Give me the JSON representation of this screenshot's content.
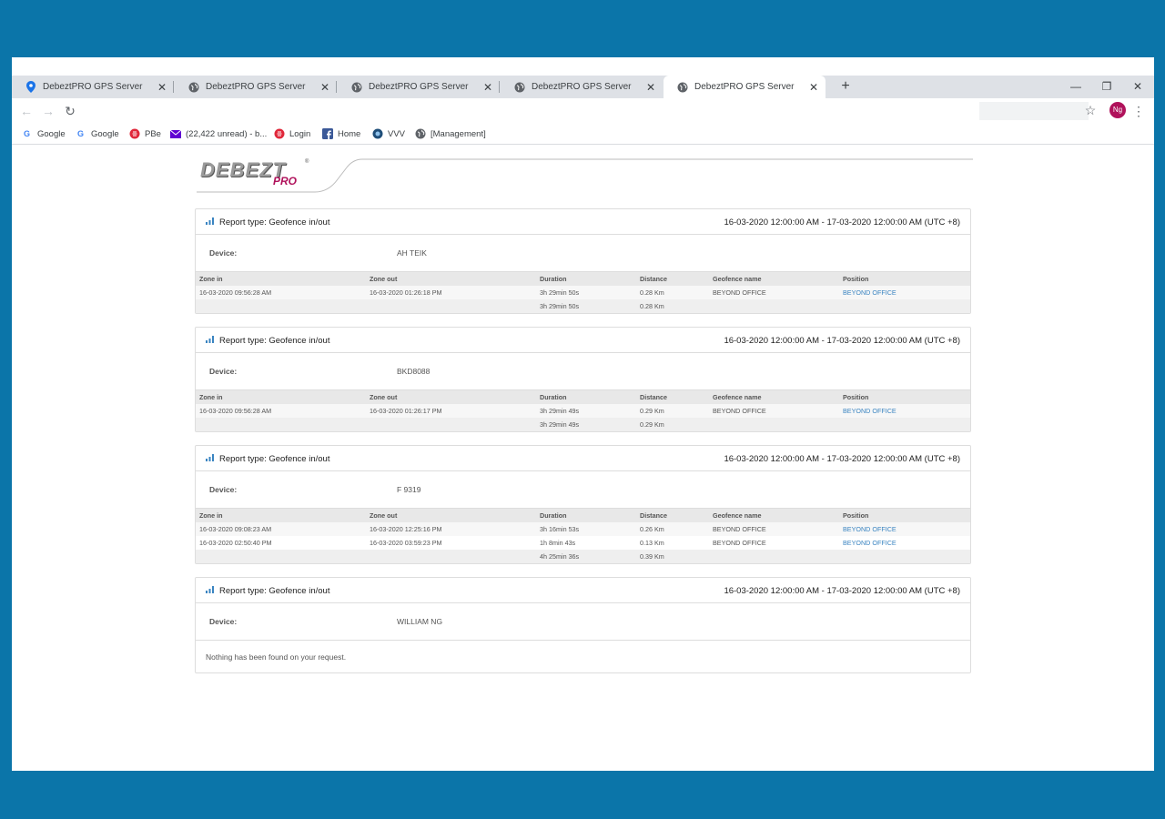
{
  "browser": {
    "tabs": [
      {
        "title": "DebeztPRO GPS Server",
        "icon": "map-pin-icon"
      },
      {
        "title": "DebeztPRO GPS Server",
        "icon": "globe-icon"
      },
      {
        "title": "DebeztPRO GPS Server",
        "icon": "globe-icon"
      },
      {
        "title": "DebeztPRO GPS Server",
        "icon": "globe-icon"
      },
      {
        "title": "DebeztPRO GPS Server",
        "icon": "globe-icon"
      }
    ],
    "active_tab": 4,
    "profile_initials": "Ng",
    "bookmarks": [
      {
        "label": "Google",
        "icon": "google-icon"
      },
      {
        "label": "Google",
        "icon": "google-icon"
      },
      {
        "label": "PBe",
        "icon": "pbe-icon"
      },
      {
        "label": "(22,422 unread) - b...",
        "icon": "mail-icon"
      },
      {
        "label": "Login",
        "icon": "pbe-icon"
      },
      {
        "label": "Home",
        "icon": "facebook-icon"
      },
      {
        "label": "VVV",
        "icon": "vvv-icon"
      },
      {
        "label": "[Management]",
        "icon": "globe-icon"
      }
    ]
  },
  "logo": {
    "main": "DEBEZT",
    "sub": "PRO",
    "tm": "®"
  },
  "reports": [
    {
      "type": "Report type: Geofence in/out",
      "range": "16-03-2020 12:00:00 AM - 17-03-2020 12:00:00 AM (UTC +8)",
      "device_label": "Device:",
      "device": "AH TEIK",
      "columns": [
        "Zone in",
        "Zone out",
        "Duration",
        "Distance",
        "Geofence name",
        "Position"
      ],
      "rows": [
        [
          "16-03-2020 09:56:28 AM",
          "16-03-2020 01:26:18 PM",
          "3h 29min 50s",
          "0.28 Km",
          "BEYOND OFFICE",
          "BEYOND OFFICE"
        ]
      ],
      "total": {
        "duration": "3h 29min 50s",
        "distance": "0.28 Km"
      }
    },
    {
      "type": "Report type: Geofence in/out",
      "range": "16-03-2020 12:00:00 AM - 17-03-2020 12:00:00 AM (UTC +8)",
      "device_label": "Device:",
      "device": "BKD8088",
      "columns": [
        "Zone in",
        "Zone out",
        "Duration",
        "Distance",
        "Geofence name",
        "Position"
      ],
      "rows": [
        [
          "16-03-2020 09:56:28 AM",
          "16-03-2020 01:26:17 PM",
          "3h 29min 49s",
          "0.29 Km",
          "BEYOND OFFICE",
          "BEYOND OFFICE"
        ]
      ],
      "total": {
        "duration": "3h 29min 49s",
        "distance": "0.29 Km"
      }
    },
    {
      "type": "Report type: Geofence in/out",
      "range": "16-03-2020 12:00:00 AM - 17-03-2020 12:00:00 AM (UTC +8)",
      "device_label": "Device:",
      "device": "F 9319",
      "columns": [
        "Zone in",
        "Zone out",
        "Duration",
        "Distance",
        "Geofence name",
        "Position"
      ],
      "rows": [
        [
          "16-03-2020 09:08:23 AM",
          "16-03-2020 12:25:16 PM",
          "3h 16min 53s",
          "0.26 Km",
          "BEYOND OFFICE",
          "BEYOND OFFICE"
        ],
        [
          "16-03-2020 02:50:40 PM",
          "16-03-2020 03:59:23 PM",
          "1h 8min 43s",
          "0.13 Km",
          "BEYOND OFFICE",
          "BEYOND OFFICE"
        ]
      ],
      "total": {
        "duration": "4h 25min 36s",
        "distance": "0.39 Km"
      }
    },
    {
      "type": "Report type: Geofence in/out",
      "range": "16-03-2020 12:00:00 AM - 17-03-2020 12:00:00 AM (UTC +8)",
      "device_label": "Device:",
      "device": "WILLIAM NG",
      "empty_message": "Nothing has been found on your request."
    }
  ],
  "colors": {
    "brand": "#b0125b",
    "frame": "#0b75a9",
    "link": "#3a84c1"
  }
}
